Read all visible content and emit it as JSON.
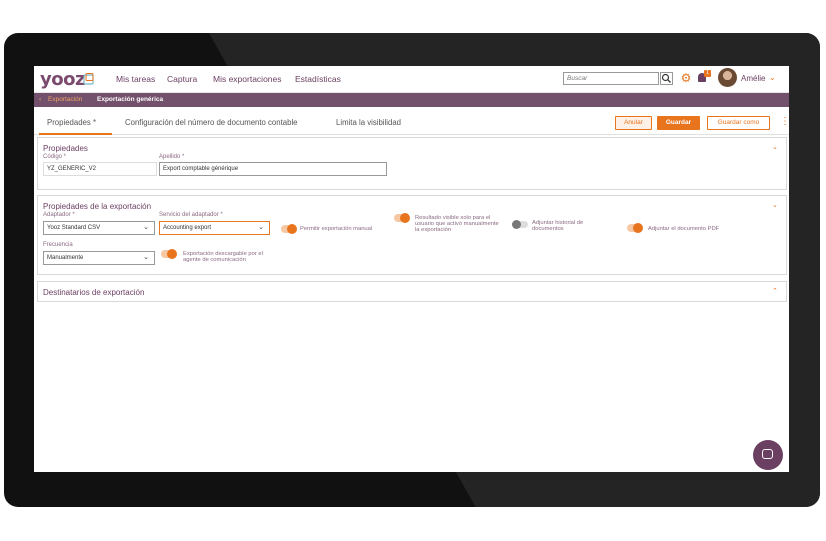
{
  "app": {
    "logo_text": "yooz"
  },
  "nav": {
    "items": [
      "Mis tareas",
      "Captura",
      "Mis exportaciones",
      "Estadísticas"
    ]
  },
  "search": {
    "placeholder": "Buscar"
  },
  "notifications": {
    "count": "1"
  },
  "user": {
    "name": "Amélie"
  },
  "breadcrumb": {
    "back": "Exportación",
    "current": "Exportación genérica"
  },
  "tabs": [
    "Propiedades *",
    "Configuración del número de documento contable",
    "Limita la visibilidad"
  ],
  "actions": {
    "cancel": "Anular",
    "save": "Guardar",
    "save_as": "Guardar como"
  },
  "properties": {
    "title": "Propiedades",
    "code_label": "Código *",
    "code_value": "YZ_GENERIC_V2",
    "surname_label": "Apellido *",
    "surname_value": "Export comptable générique"
  },
  "export_props": {
    "title": "Propiedades de la exportación",
    "adapter_label": "Adaptador *",
    "adapter_value": "Yooz Standard CSV",
    "service_label": "Servicio del adaptador *",
    "service_value": "Accounting export",
    "allow_manual": "Permitir exportación manual",
    "result_visible": "Resultado visible solo para el usuario que activó manualmente la exportación",
    "attach_history": "Adjuntar historial de documentos",
    "attach_pdf": "Adjuntar el documento PDF",
    "frequency_label": "Frecuencia",
    "frequency_value": "Manualmente",
    "downloadable": "Exportación descargable por el agente de comunicación"
  },
  "recipients": {
    "title": "Destinatarios de exportación"
  },
  "colors": {
    "brand": "#6b3f62",
    "accent": "#e8741e"
  }
}
